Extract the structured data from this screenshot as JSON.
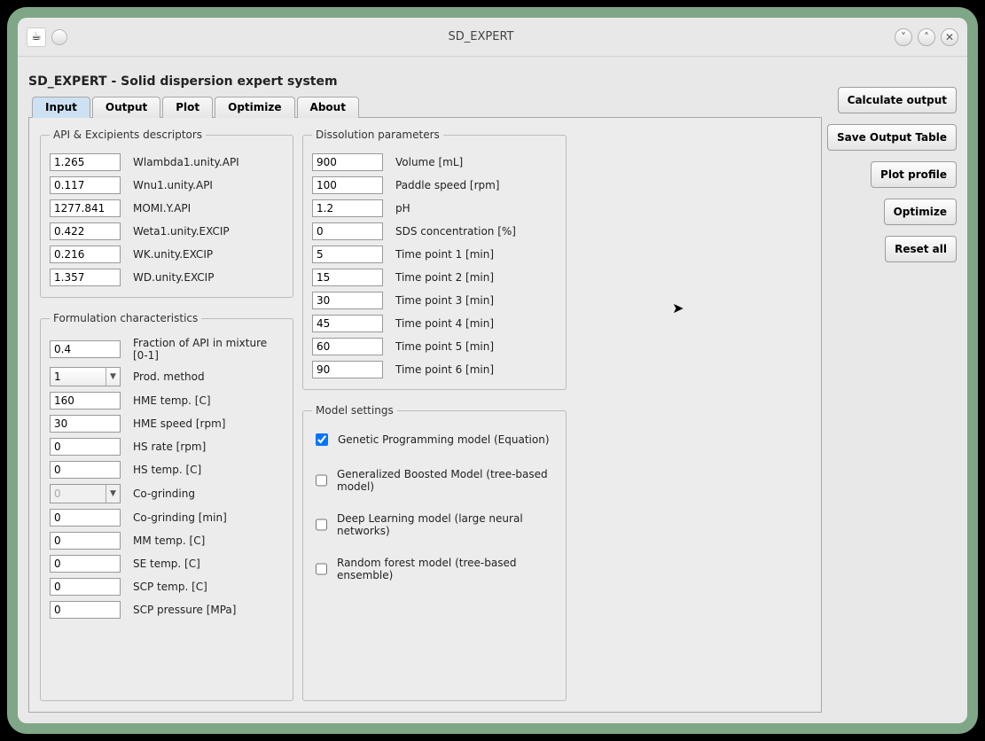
{
  "window": {
    "title": "SD_EXPERT"
  },
  "page_title": "SD_EXPERT - Solid dispersion expert system",
  "tabs": [
    "Input",
    "Output",
    "Plot",
    "Optimize",
    "About"
  ],
  "active_tab": "Input",
  "section_api": {
    "legend": "API & Excipients descriptors",
    "rows": [
      {
        "value": "1.265",
        "label": "Wlambda1.unity.API"
      },
      {
        "value": "0.117",
        "label": "Wnu1.unity.API"
      },
      {
        "value": "1277.841",
        "label": "MOMI.Y.API"
      },
      {
        "value": "0.422",
        "label": "Weta1.unity.EXCIP"
      },
      {
        "value": "0.216",
        "label": "WK.unity.EXCIP"
      },
      {
        "value": "1.357",
        "label": "WD.unity.EXCIP"
      }
    ]
  },
  "section_form": {
    "legend": "Formulation characteristics",
    "rows": [
      {
        "type": "text",
        "value": "0.4",
        "label": "Fraction of API in mixture [0-1]"
      },
      {
        "type": "combo",
        "value": "1",
        "label": "Prod. method",
        "disabled": false
      },
      {
        "type": "text",
        "value": "160",
        "label": "HME temp. [C]"
      },
      {
        "type": "text",
        "value": "30",
        "label": "HME speed [rpm]"
      },
      {
        "type": "text",
        "value": "0",
        "label": "HS rate [rpm]"
      },
      {
        "type": "text",
        "value": "0",
        "label": "HS temp. [C]"
      },
      {
        "type": "combo",
        "value": "0",
        "label": "Co-grinding",
        "disabled": true
      },
      {
        "type": "text",
        "value": "0",
        "label": "Co-grinding [min]"
      },
      {
        "type": "text",
        "value": "0",
        "label": "MM temp. [C]"
      },
      {
        "type": "text",
        "value": "0",
        "label": "SE temp. [C]"
      },
      {
        "type": "text",
        "value": "0",
        "label": "SCP temp. [C]"
      },
      {
        "type": "text",
        "value": "0",
        "label": "SCP pressure [MPa]"
      }
    ]
  },
  "section_diss": {
    "legend": "Dissolution parameters",
    "rows": [
      {
        "value": "900",
        "label": "Volume [mL]"
      },
      {
        "value": "100",
        "label": "Paddle speed [rpm]"
      },
      {
        "value": "1.2",
        "label": "pH"
      },
      {
        "value": "0",
        "label": "SDS concentration [%]"
      },
      {
        "value": "5",
        "label": "Time point 1 [min]"
      },
      {
        "value": "15",
        "label": "Time point 2 [min]"
      },
      {
        "value": "30",
        "label": "Time point 3 [min]"
      },
      {
        "value": "45",
        "label": "Time point 4 [min]"
      },
      {
        "value": "60",
        "label": "Time point 5 [min]"
      },
      {
        "value": "90",
        "label": "Time point 6 [min]"
      }
    ]
  },
  "section_model": {
    "legend": "Model settings",
    "rows": [
      {
        "checked": true,
        "label": "Genetic Programming model (Equation)"
      },
      {
        "checked": false,
        "label": "Generalized Boosted Model (tree-based model)"
      },
      {
        "checked": false,
        "label": "Deep Learning model (large neural networks)"
      },
      {
        "checked": false,
        "label": "Random forest model (tree-based ensemble)"
      }
    ]
  },
  "side_buttons": [
    "Calculate output",
    "Save Output Table",
    "Plot profile",
    "Optimize",
    "Reset all"
  ]
}
